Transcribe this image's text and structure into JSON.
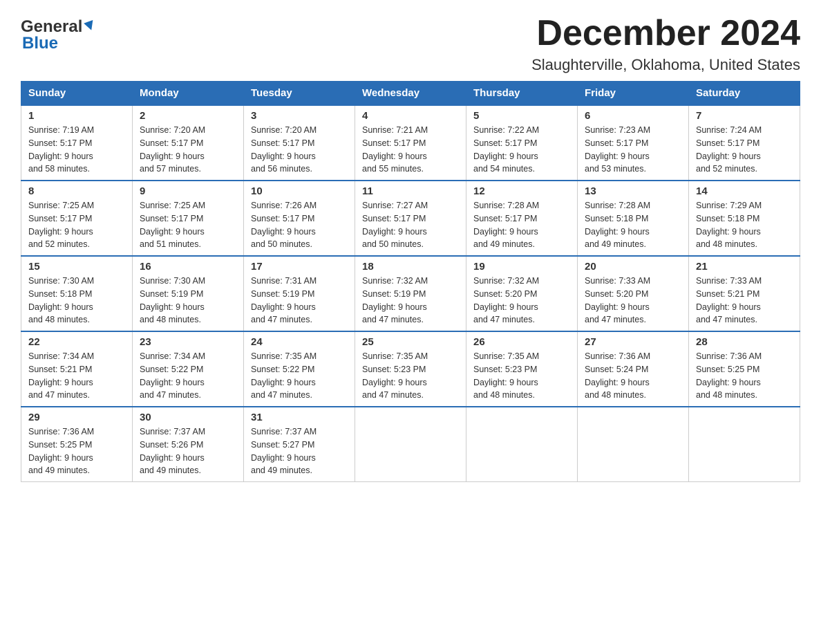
{
  "logo": {
    "part1": "General",
    "part2": "Blue"
  },
  "title": "December 2024",
  "subtitle": "Slaughterville, Oklahoma, United States",
  "weekdays": [
    "Sunday",
    "Monday",
    "Tuesday",
    "Wednesday",
    "Thursday",
    "Friday",
    "Saturday"
  ],
  "weeks": [
    [
      {
        "day": "1",
        "info": "Sunrise: 7:19 AM\nSunset: 5:17 PM\nDaylight: 9 hours\nand 58 minutes."
      },
      {
        "day": "2",
        "info": "Sunrise: 7:20 AM\nSunset: 5:17 PM\nDaylight: 9 hours\nand 57 minutes."
      },
      {
        "day": "3",
        "info": "Sunrise: 7:20 AM\nSunset: 5:17 PM\nDaylight: 9 hours\nand 56 minutes."
      },
      {
        "day": "4",
        "info": "Sunrise: 7:21 AM\nSunset: 5:17 PM\nDaylight: 9 hours\nand 55 minutes."
      },
      {
        "day": "5",
        "info": "Sunrise: 7:22 AM\nSunset: 5:17 PM\nDaylight: 9 hours\nand 54 minutes."
      },
      {
        "day": "6",
        "info": "Sunrise: 7:23 AM\nSunset: 5:17 PM\nDaylight: 9 hours\nand 53 minutes."
      },
      {
        "day": "7",
        "info": "Sunrise: 7:24 AM\nSunset: 5:17 PM\nDaylight: 9 hours\nand 52 minutes."
      }
    ],
    [
      {
        "day": "8",
        "info": "Sunrise: 7:25 AM\nSunset: 5:17 PM\nDaylight: 9 hours\nand 52 minutes."
      },
      {
        "day": "9",
        "info": "Sunrise: 7:25 AM\nSunset: 5:17 PM\nDaylight: 9 hours\nand 51 minutes."
      },
      {
        "day": "10",
        "info": "Sunrise: 7:26 AM\nSunset: 5:17 PM\nDaylight: 9 hours\nand 50 minutes."
      },
      {
        "day": "11",
        "info": "Sunrise: 7:27 AM\nSunset: 5:17 PM\nDaylight: 9 hours\nand 50 minutes."
      },
      {
        "day": "12",
        "info": "Sunrise: 7:28 AM\nSunset: 5:17 PM\nDaylight: 9 hours\nand 49 minutes."
      },
      {
        "day": "13",
        "info": "Sunrise: 7:28 AM\nSunset: 5:18 PM\nDaylight: 9 hours\nand 49 minutes."
      },
      {
        "day": "14",
        "info": "Sunrise: 7:29 AM\nSunset: 5:18 PM\nDaylight: 9 hours\nand 48 minutes."
      }
    ],
    [
      {
        "day": "15",
        "info": "Sunrise: 7:30 AM\nSunset: 5:18 PM\nDaylight: 9 hours\nand 48 minutes."
      },
      {
        "day": "16",
        "info": "Sunrise: 7:30 AM\nSunset: 5:19 PM\nDaylight: 9 hours\nand 48 minutes."
      },
      {
        "day": "17",
        "info": "Sunrise: 7:31 AM\nSunset: 5:19 PM\nDaylight: 9 hours\nand 47 minutes."
      },
      {
        "day": "18",
        "info": "Sunrise: 7:32 AM\nSunset: 5:19 PM\nDaylight: 9 hours\nand 47 minutes."
      },
      {
        "day": "19",
        "info": "Sunrise: 7:32 AM\nSunset: 5:20 PM\nDaylight: 9 hours\nand 47 minutes."
      },
      {
        "day": "20",
        "info": "Sunrise: 7:33 AM\nSunset: 5:20 PM\nDaylight: 9 hours\nand 47 minutes."
      },
      {
        "day": "21",
        "info": "Sunrise: 7:33 AM\nSunset: 5:21 PM\nDaylight: 9 hours\nand 47 minutes."
      }
    ],
    [
      {
        "day": "22",
        "info": "Sunrise: 7:34 AM\nSunset: 5:21 PM\nDaylight: 9 hours\nand 47 minutes."
      },
      {
        "day": "23",
        "info": "Sunrise: 7:34 AM\nSunset: 5:22 PM\nDaylight: 9 hours\nand 47 minutes."
      },
      {
        "day": "24",
        "info": "Sunrise: 7:35 AM\nSunset: 5:22 PM\nDaylight: 9 hours\nand 47 minutes."
      },
      {
        "day": "25",
        "info": "Sunrise: 7:35 AM\nSunset: 5:23 PM\nDaylight: 9 hours\nand 47 minutes."
      },
      {
        "day": "26",
        "info": "Sunrise: 7:35 AM\nSunset: 5:23 PM\nDaylight: 9 hours\nand 48 minutes."
      },
      {
        "day": "27",
        "info": "Sunrise: 7:36 AM\nSunset: 5:24 PM\nDaylight: 9 hours\nand 48 minutes."
      },
      {
        "day": "28",
        "info": "Sunrise: 7:36 AM\nSunset: 5:25 PM\nDaylight: 9 hours\nand 48 minutes."
      }
    ],
    [
      {
        "day": "29",
        "info": "Sunrise: 7:36 AM\nSunset: 5:25 PM\nDaylight: 9 hours\nand 49 minutes."
      },
      {
        "day": "30",
        "info": "Sunrise: 7:37 AM\nSunset: 5:26 PM\nDaylight: 9 hours\nand 49 minutes."
      },
      {
        "day": "31",
        "info": "Sunrise: 7:37 AM\nSunset: 5:27 PM\nDaylight: 9 hours\nand 49 minutes."
      },
      null,
      null,
      null,
      null
    ]
  ]
}
